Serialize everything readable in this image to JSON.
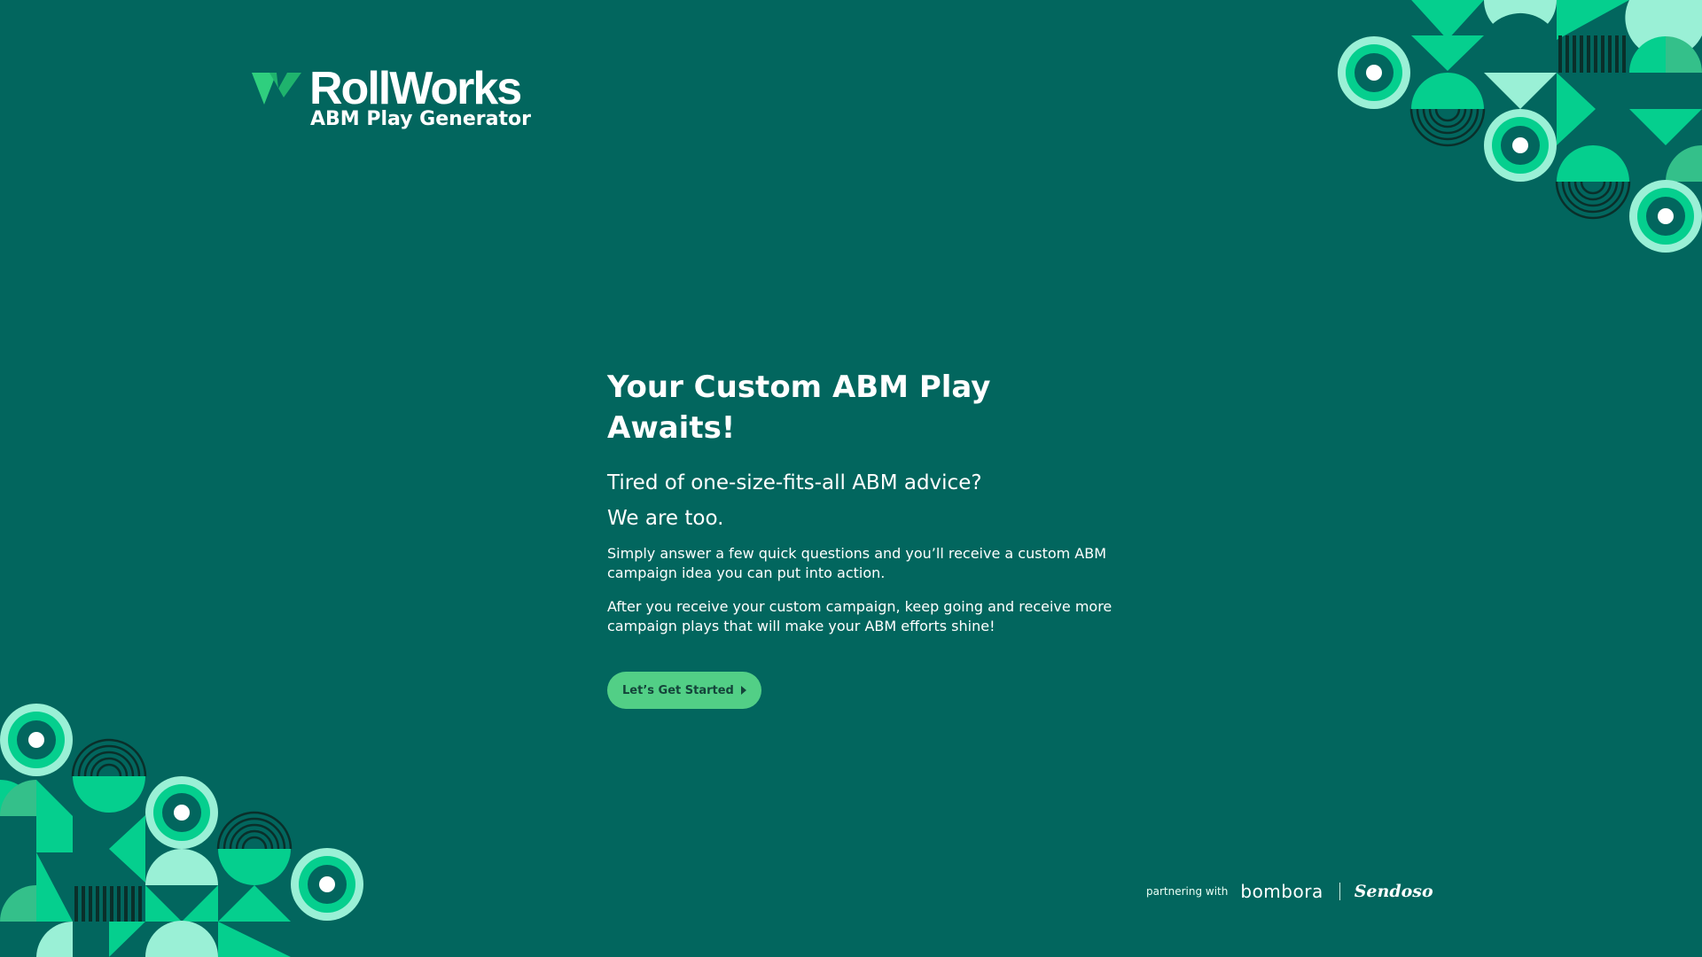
{
  "brand": {
    "name": "RollWorks",
    "product": "ABM Play Generator"
  },
  "hero": {
    "title": "Your Custom ABM Play Awaits!",
    "lead_1": "Tired of one-size-fits-all ABM advice?",
    "lead_2": "We are too.",
    "para_1": "Simply answer a few quick questions and you’ll receive a custom ABM campaign idea you can put into action.",
    "para_2": "After you receive your custom campaign, keep going and receive more campaign plays that will make your ABM efforts shine!",
    "cta_label": "Let’s Get Started",
    "cta_icon": "caret-right-icon"
  },
  "partners": {
    "prefix": "partnering with",
    "partner_1": "bombora",
    "partner_2": "Sendoso"
  },
  "colors": {
    "background": "#02665e",
    "accent": "#52cf86",
    "bright_green": "#05cf8e",
    "mint": "#9af0d6",
    "dark_teal": "#053d36"
  }
}
